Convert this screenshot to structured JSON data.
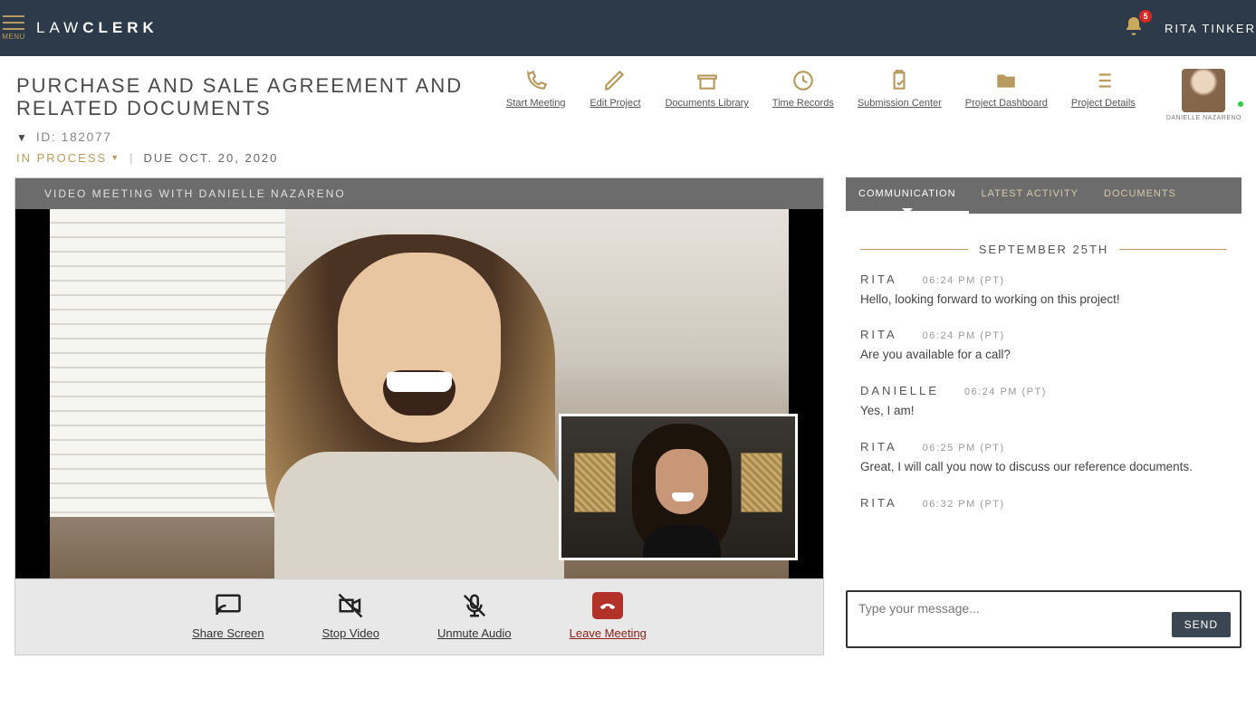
{
  "header": {
    "menu_label": "MENU",
    "logo_light": "LAW",
    "logo_bold": "CLERK",
    "notification_count": "5",
    "user_display": "RITA TINKER"
  },
  "project": {
    "title": "PURCHASE AND SALE AGREEMENT AND RELATED DOCUMENTS",
    "id_label": "ID: 182077",
    "status": "IN PROCESS",
    "due": "DUE OCT. 20, 2020"
  },
  "tools": {
    "start_meeting": "Start Meeting",
    "edit_project": "Edit Project",
    "documents_library": "Documents Library",
    "time_records": "Time Records",
    "submission_center": "Submission Center",
    "project_dashboard": "Project Dashboard",
    "project_details": "Project Details",
    "assignee_name": "DANIELLE NAZARENO"
  },
  "video": {
    "title": "VIDEO MEETING WITH DANIELLE NAZARENO",
    "share_screen": "Share Screen",
    "stop_video": "Stop Video",
    "unmute_audio": "Unmute Audio",
    "leave_meeting": "Leave Meeting"
  },
  "tabs": {
    "communication": "COMMUNICATION",
    "latest_activity": "LATEST ACTIVITY",
    "documents": "DOCUMENTS"
  },
  "chat": {
    "date": "SEPTEMBER 25TH",
    "messages": [
      {
        "from": "RITA",
        "time": "06:24 PM (PT)",
        "body": "Hello, looking forward to working on this project!"
      },
      {
        "from": "RITA",
        "time": "06:24 PM (PT)",
        "body": "Are you available for a call?"
      },
      {
        "from": "DANIELLE",
        "time": "06:24 PM (PT)",
        "body": "Yes, I am!"
      },
      {
        "from": "RITA",
        "time": "06:25 PM (PT)",
        "body": "Great, I will call you now to discuss our reference documents."
      },
      {
        "from": "RITA",
        "time": "06:32 PM (PT)",
        "body": ""
      }
    ],
    "placeholder": "Type your message...",
    "send": "SEND"
  }
}
